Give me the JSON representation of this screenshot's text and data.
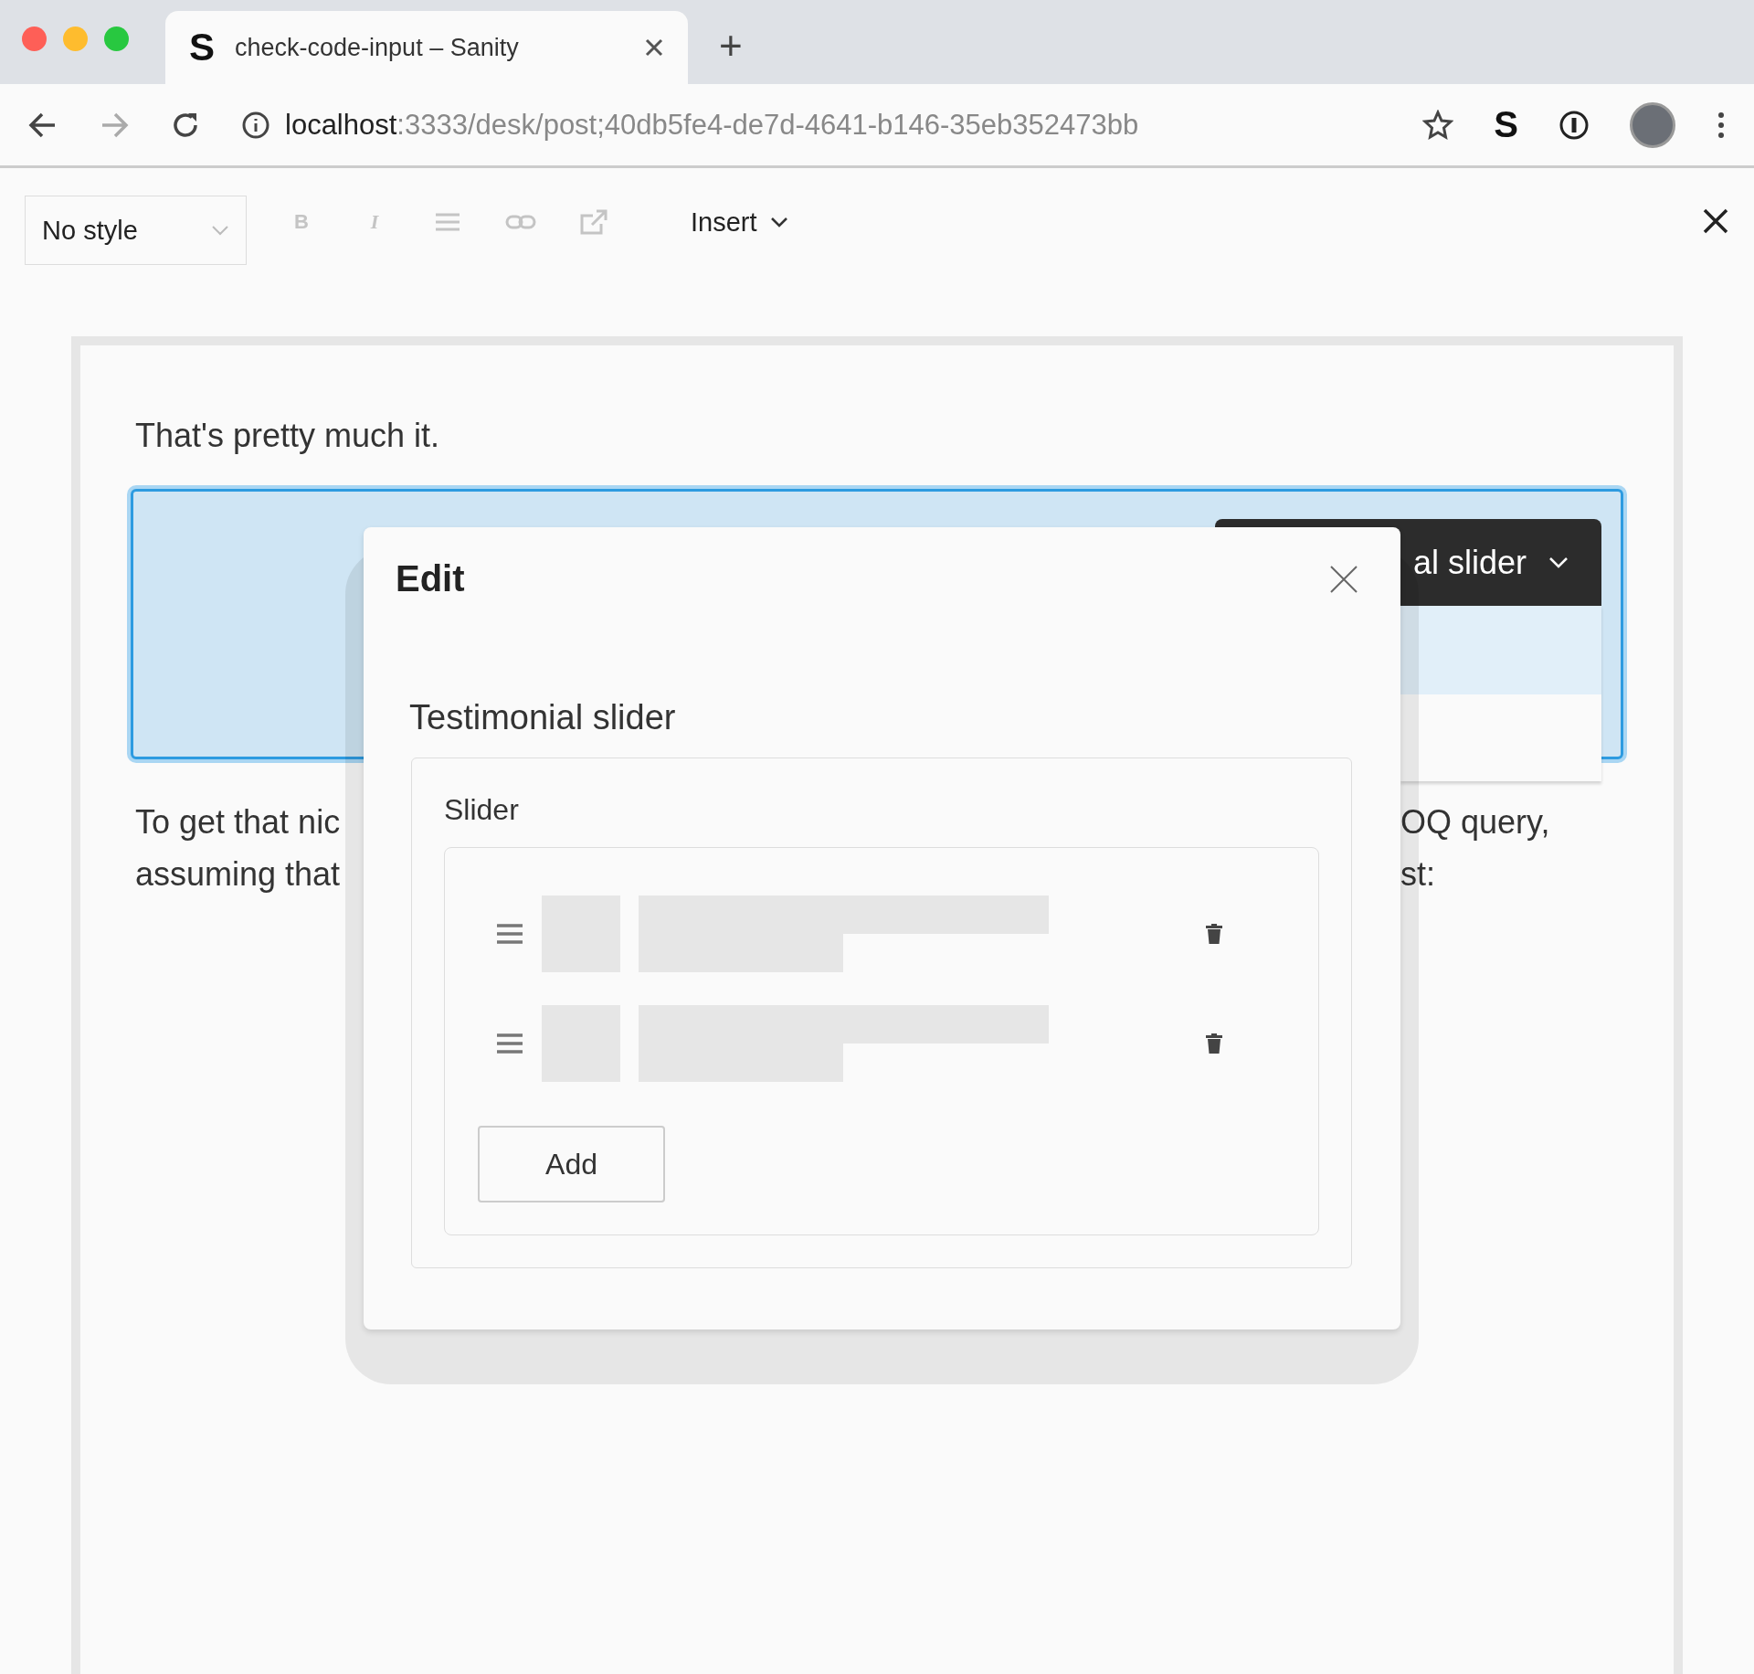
{
  "browser": {
    "tab": {
      "logo": "S",
      "title": "check-code-input – Sanity"
    },
    "new_tab": "+",
    "address": {
      "host": "localhost",
      "path": ":3333/desk/post;40db5fe4-de7d-4641-b146-35eb352473bb"
    },
    "extension": "S"
  },
  "toolbar": {
    "style_select": "No style",
    "format_buttons": [
      {
        "kind": "bold",
        "label": "B",
        "disabled": true
      },
      {
        "kind": "italic",
        "label": "I",
        "disabled": true
      },
      {
        "kind": "list",
        "disabled": true
      },
      {
        "kind": "link",
        "disabled": true
      },
      {
        "kind": "external",
        "disabled": true
      }
    ],
    "insert": "Insert"
  },
  "document": {
    "paragraph": "That's pretty much it.",
    "block": {
      "selected": true,
      "header": "al slider"
    },
    "after_left": [
      "To get that nic",
      "assuming that"
    ],
    "after_right": [
      "OQ query,",
      "st:"
    ]
  },
  "modal": {
    "title": "Edit",
    "section": "Testimonial slider",
    "field": "Slider",
    "items": [
      {
        "loading": true
      },
      {
        "loading": true
      }
    ],
    "add_button": "Add"
  }
}
